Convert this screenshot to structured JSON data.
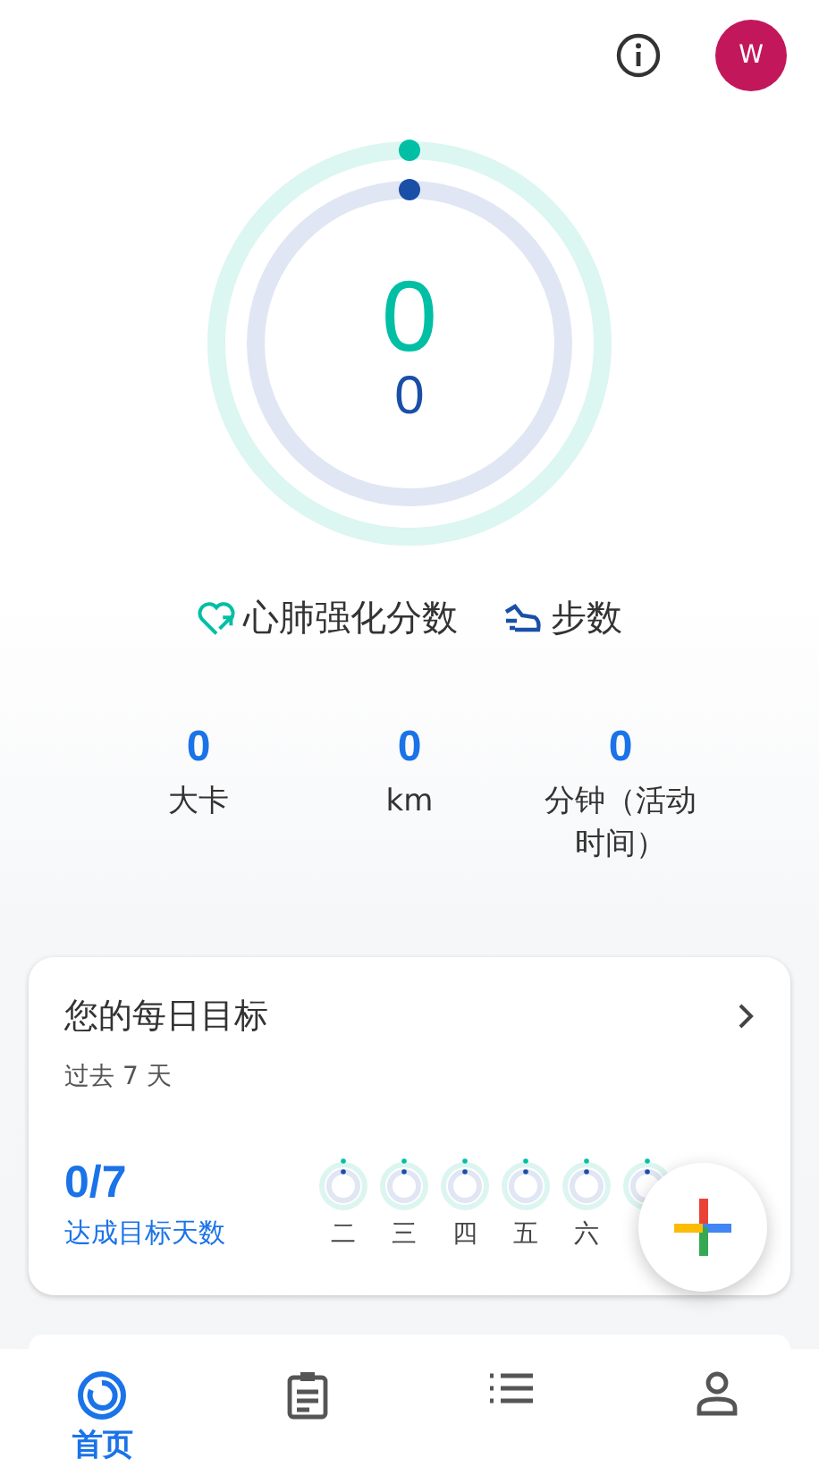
{
  "header": {
    "avatar_letter": "W"
  },
  "rings": {
    "heart_points": "0",
    "steps": "0"
  },
  "legend": [
    {
      "kind": "heart",
      "label": "心肺强化分数"
    },
    {
      "kind": "steps",
      "label": "步数"
    }
  ],
  "stats": [
    {
      "value": "0",
      "label": "大卡"
    },
    {
      "value": "0",
      "label": "km"
    },
    {
      "value": "0",
      "label": "分钟（活动时间）"
    }
  ],
  "daily_goal": {
    "title": "您的每日目标",
    "subtitle": "过去 7 天",
    "count": "0/7",
    "caption": "达成目标天数",
    "days": [
      {
        "label": "二"
      },
      {
        "label": "三"
      },
      {
        "label": "四"
      },
      {
        "label": "五"
      },
      {
        "label": "六"
      }
    ]
  },
  "nav": [
    {
      "kind": "home",
      "label": "首页",
      "selected": true
    },
    {
      "kind": "journal",
      "selected": false
    },
    {
      "kind": "browse",
      "selected": false
    },
    {
      "kind": "profile",
      "selected": false
    }
  ]
}
